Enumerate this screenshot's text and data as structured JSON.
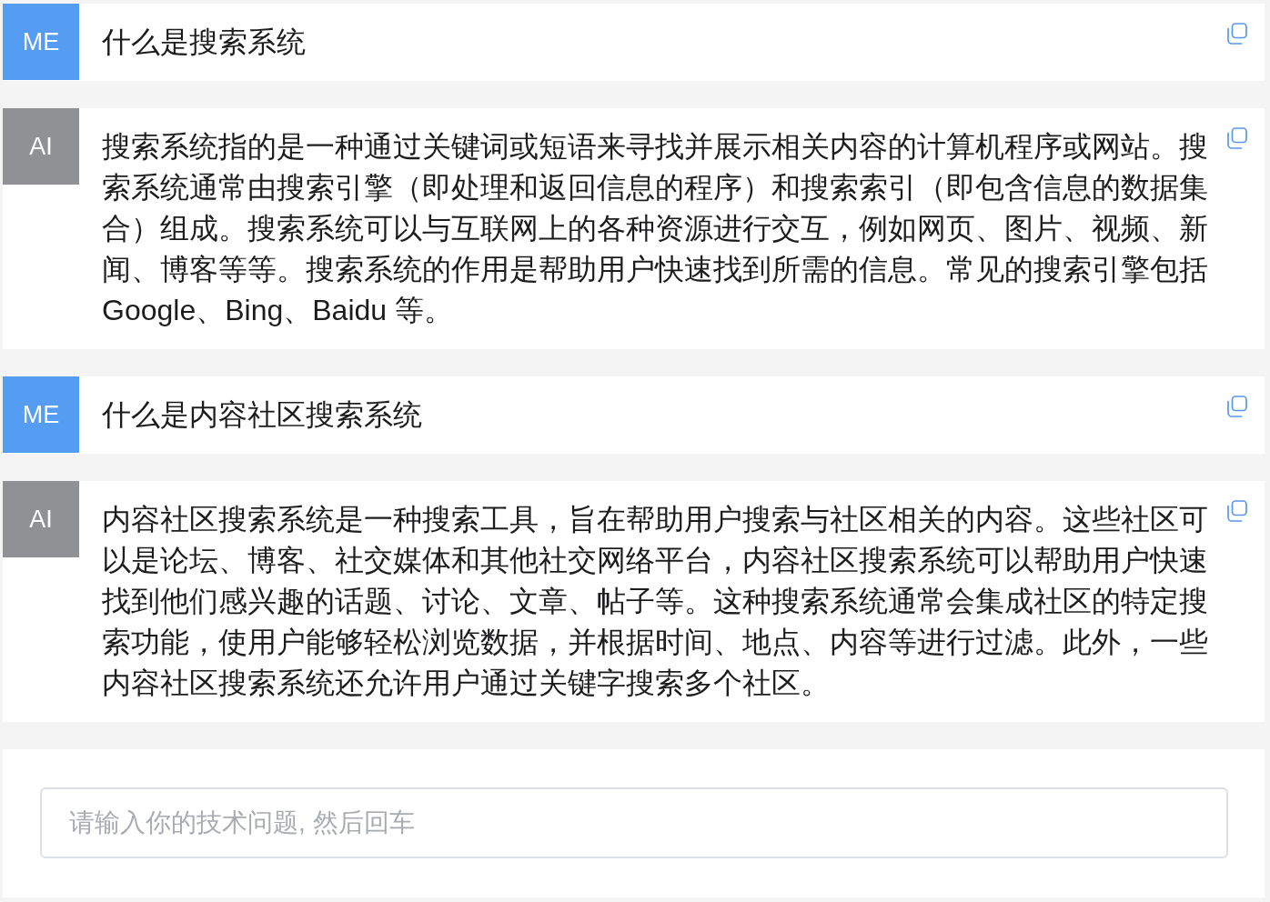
{
  "messages": [
    {
      "kind": "user",
      "sender": "ME",
      "text": "什么是搜索系统"
    },
    {
      "kind": "ai",
      "sender": "AI",
      "text": "搜索系统指的是一种通过关键词或短语来寻找并展示相关内容的计算机程序或网站。搜索系统通常由搜索引擎（即处理和返回信息的程序）和搜索索引（即包含信息的数据集合）组成。搜索系统可以与互联网上的各种资源进行交互，例如网页、图片、视频、新闻、博客等等。搜索系统的作用是帮助用户快速找到所需的信息。常见的搜索引擎包括 Google、Bing、Baidu 等。"
    },
    {
      "kind": "user",
      "sender": "ME",
      "text": "什么是内容社区搜索系统"
    },
    {
      "kind": "ai",
      "sender": "AI",
      "text": "内容社区搜索系统是一种搜索工具，旨在帮助用户搜索与社区相关的内容。这些社区可以是论坛、博客、社交媒体和其他社交网络平台，内容社区搜索系统可以帮助用户快速找到他们感兴趣的话题、讨论、文章、帖子等。这种搜索系统通常会集成社区的特定搜索功能，使用户能够轻松浏览数据，并根据时间、地点、内容等进行过滤。此外，一些内容社区搜索系统还允许用户通过关键字搜索多个社区。"
    }
  ],
  "input": {
    "placeholder": "请输入你的技术问题, 然后回车"
  }
}
